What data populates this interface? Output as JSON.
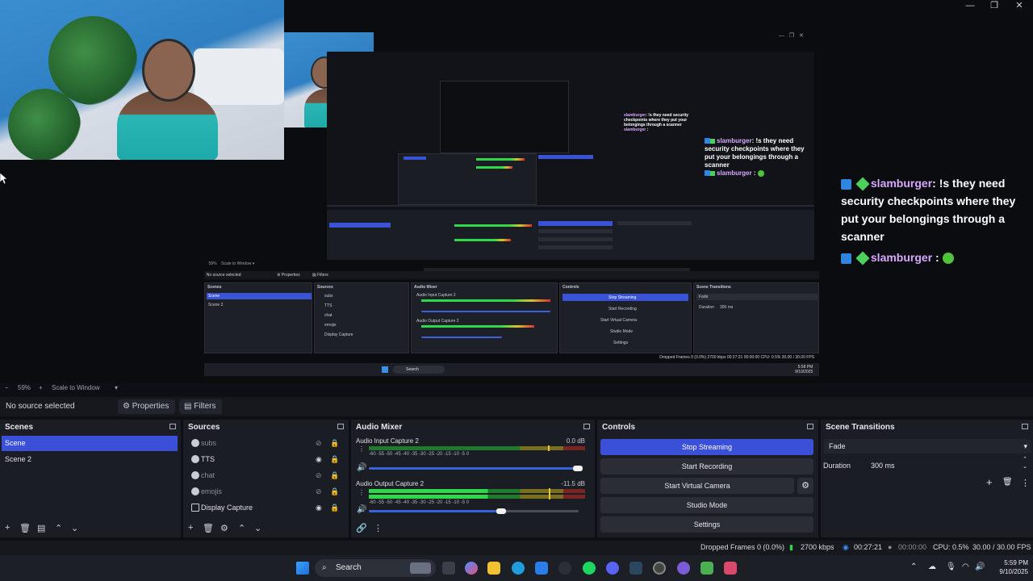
{
  "window_controls": {
    "minimize": "—",
    "restore": "❐",
    "close": "✕"
  },
  "chat": {
    "messages": [
      {
        "user": "slamburger",
        "text": ": !s they need security checkpoints where they put your belongings through a scanner"
      },
      {
        "user": "slamburger",
        "text": ":"
      }
    ]
  },
  "inner_obs": {
    "no_source": "No source selected",
    "properties": "Properties",
    "filters": "Filters",
    "docks": {
      "scenes": "Scenes",
      "sources": "Sources",
      "mixer": "Audio Mixer",
      "controls": "Controls",
      "transitions": "Scene Transitions"
    },
    "scenes": [
      "Scene",
      "Scene 2"
    ],
    "sources": [
      "subs",
      "TTS",
      "chat",
      "emojis",
      "Display Capture"
    ],
    "mixer": [
      "Audio Input Capture 2",
      "Audio Output Capture 2"
    ],
    "controls": [
      "Stop Streaming",
      "Start Recording",
      "Start Virtual Camera",
      "Studio Mode",
      "Settings"
    ],
    "transition": "Fade",
    "duration_label": "Duration",
    "duration": "300 ms",
    "status": "Dropped Frames 0 (0.0%)   2700 kbps   00:27:21   00:00:00   CPU: 0.5%   30.00 / 30.00 FPS",
    "taskbar_search": "Search",
    "clock_time": "5:58 PM",
    "clock_date": "9/10/2025"
  },
  "preview_status": {
    "zoom": "59%",
    "scale": "Scale to Window"
  },
  "toolbar": {
    "no_source": "No source selected",
    "properties": "Properties",
    "filters": "Filters"
  },
  "docks": {
    "scenes": {
      "title": "Scenes",
      "items": [
        "Scene",
        "Scene 2"
      ],
      "selected": 0
    },
    "sources": {
      "title": "Sources",
      "items": [
        {
          "name": "subs",
          "visible": false
        },
        {
          "name": "TTS",
          "visible": true
        },
        {
          "name": "chat",
          "visible": false
        },
        {
          "name": "emojis",
          "visible": false
        },
        {
          "name": "Display Capture",
          "visible": true
        }
      ]
    },
    "mixer": {
      "title": "Audio Mixer",
      "channels": [
        {
          "name": "Audio Input Capture 2",
          "db": "0.0 dB",
          "level": 0.0
        },
        {
          "name": "Audio Output Capture 2",
          "db": "-11.5 dB",
          "level": 0.55
        }
      ],
      "ticks": "-60  -55  -50  -45  -40  -35  -30  -25  -20  -15  -10  -5  0"
    },
    "controls": {
      "title": "Controls",
      "buttons": [
        "Stop Streaming",
        "Start Recording",
        "Start Virtual Camera",
        "Studio Mode",
        "Settings"
      ]
    },
    "transitions": {
      "title": "Scene Transitions",
      "selected": "Fade",
      "duration_label": "Duration",
      "duration": "300 ms"
    }
  },
  "stats": {
    "dropped": "Dropped Frames 0 (0.0%)",
    "bitrate": "2700 kbps",
    "stream_time": "00:27:21",
    "record_time": "00:00:00",
    "cpu": "CPU: 0.5%",
    "fps": "30.00 / 30.00 FPS"
  },
  "taskbar": {
    "search": "Search",
    "time": "5:59 PM",
    "date": "9/10/2025"
  },
  "colors": {
    "accent": "#3a50d8",
    "meter_green": "#2fd84a",
    "meter_yellow": "#d6c42b",
    "meter_red": "#d83232",
    "chat_name": "#d9a8ff"
  }
}
